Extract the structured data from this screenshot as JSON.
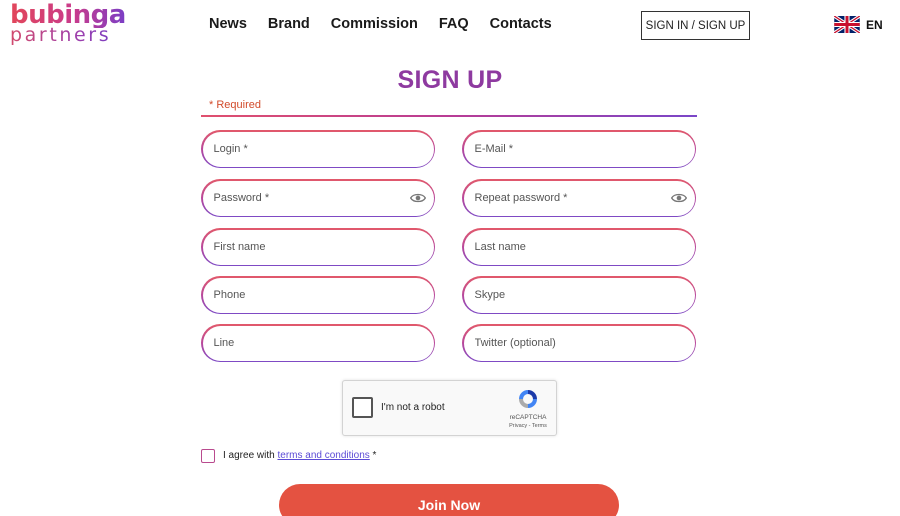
{
  "logo": {
    "line1": "bubinga",
    "line2": "partners"
  },
  "nav": [
    "News",
    "Brand",
    "Commission",
    "FAQ",
    "Contacts"
  ],
  "header": {
    "signin_label": "SIGN IN / SIGN UP",
    "language": "EN",
    "language_flag_icon": "uk-flag-icon"
  },
  "form": {
    "title": "SIGN UP",
    "required_note": "* Required",
    "fields": {
      "login": "Login *",
      "email": "E-Mail *",
      "password": "Password *",
      "repeat_password": "Repeat password *",
      "first_name": "First name",
      "last_name": "Last name",
      "phone": "Phone",
      "skype": "Skype",
      "line": "Line",
      "twitter": "Twitter (optional)"
    },
    "captcha": {
      "label": "I'm not a robot",
      "brand": "reCAPTCHA",
      "links": "Privacy - Terms"
    },
    "agree": {
      "prefix": "I agree with ",
      "link": "terms and conditions",
      "suffix": " *"
    },
    "submit_label": "Join Now"
  },
  "colors": {
    "accent": "#8e3aa0",
    "join_button": "#e45241",
    "required": "#d24a2a",
    "link": "#5b4bd6"
  }
}
